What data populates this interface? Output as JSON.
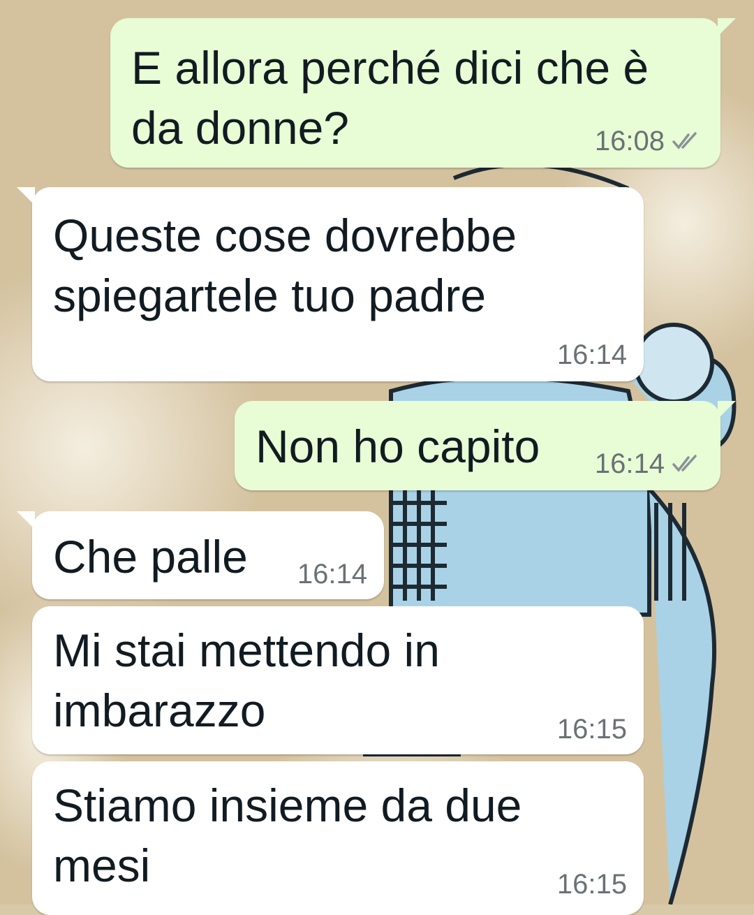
{
  "messages": [
    {
      "direction": "out",
      "text": "E allora perché dici che è\nda donne?",
      "time": "16:08",
      "status_icon": "double-check-icon"
    },
    {
      "direction": "in",
      "text": "Queste cose dovrebbe\nspiegartele tuo padre",
      "time": "16:14"
    },
    {
      "direction": "out",
      "text": "Non ho capito",
      "time": "16:14",
      "status_icon": "double-check-icon"
    },
    {
      "direction": "in",
      "text": "Che palle",
      "time": "16:14"
    },
    {
      "direction": "in",
      "text": "Mi stai mettendo in\nimbarazzo",
      "time": "16:15"
    },
    {
      "direction": "in",
      "text": "Stiamo insieme da due\nmesi",
      "time": "16:15"
    }
  ],
  "colors": {
    "outgoing_bubble": "#e8fcd5",
    "incoming_bubble": "#ffffff",
    "timestamp": "#6a7175",
    "check": "#8a9196"
  }
}
